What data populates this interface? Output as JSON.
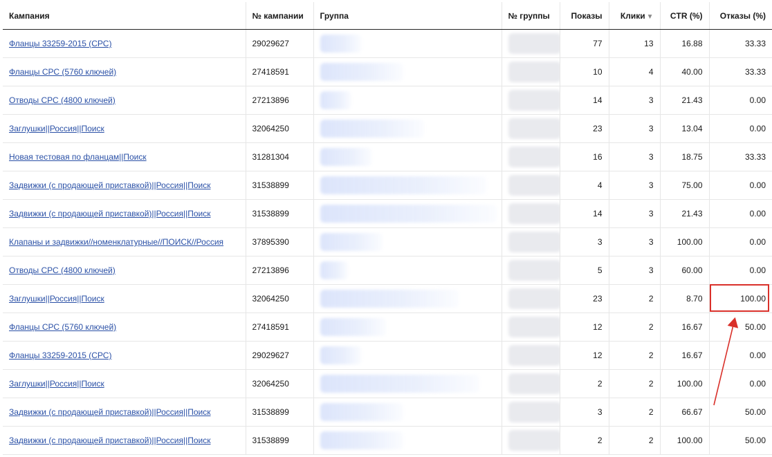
{
  "table": {
    "headers": {
      "campaign": "Кампания",
      "campaign_no": "№ кампании",
      "group": "Группа",
      "group_no": "№ группы",
      "impressions": "Показы",
      "clicks": "Клики",
      "ctr": "CTR (%)",
      "bounces": "Отказы (%)"
    },
    "sort_column": "clicks",
    "sort_icon": "sort-desc-icon",
    "rows": [
      {
        "campaign": "Фланцы 33259-2015 (СРС)",
        "campaign_no": "29029627",
        "impressions": "77",
        "clicks": "13",
        "ctr": "16.88",
        "bounces": "33.33"
      },
      {
        "campaign": "Фланцы СРС (5760 ключей)",
        "campaign_no": "27418591",
        "impressions": "10",
        "clicks": "4",
        "ctr": "40.00",
        "bounces": "33.33"
      },
      {
        "campaign": "Отводы СРС (4800 ключей)",
        "campaign_no": "27213896",
        "impressions": "14",
        "clicks": "3",
        "ctr": "21.43",
        "bounces": "0.00"
      },
      {
        "campaign": "Заглушки||Россия||Поиск",
        "campaign_no": "32064250",
        "impressions": "23",
        "clicks": "3",
        "ctr": "13.04",
        "bounces": "0.00"
      },
      {
        "campaign": "Новая тестовая по фланцам||Поиск",
        "campaign_no": "31281304",
        "impressions": "16",
        "clicks": "3",
        "ctr": "18.75",
        "bounces": "33.33"
      },
      {
        "campaign": "Задвижки (с продающей приставкой)||Россия||Поиск",
        "campaign_no": "31538899",
        "impressions": "4",
        "clicks": "3",
        "ctr": "75.00",
        "bounces": "0.00"
      },
      {
        "campaign": "Задвижки (с продающей приставкой)||Россия||Поиск",
        "campaign_no": "31538899",
        "impressions": "14",
        "clicks": "3",
        "ctr": "21.43",
        "bounces": "0.00"
      },
      {
        "campaign": "Клапаны и задвижки//номенклатурные//ПОИСК//Россия",
        "campaign_no": "37895390",
        "impressions": "3",
        "clicks": "3",
        "ctr": "100.00",
        "bounces": "0.00"
      },
      {
        "campaign": "Отводы СРС (4800 ключей)",
        "campaign_no": "27213896",
        "impressions": "5",
        "clicks": "3",
        "ctr": "60.00",
        "bounces": "0.00"
      },
      {
        "campaign": "Заглушки||Россия||Поиск",
        "campaign_no": "32064250",
        "impressions": "23",
        "clicks": "2",
        "ctr": "8.70",
        "bounces": "100.00"
      },
      {
        "campaign": "Фланцы СРС (5760 ключей)",
        "campaign_no": "27418591",
        "impressions": "12",
        "clicks": "2",
        "ctr": "16.67",
        "bounces": "50.00"
      },
      {
        "campaign": "Фланцы 33259-2015 (СРС)",
        "campaign_no": "29029627",
        "impressions": "12",
        "clicks": "2",
        "ctr": "16.67",
        "bounces": "0.00"
      },
      {
        "campaign": "Заглушки||Россия||Поиск",
        "campaign_no": "32064250",
        "impressions": "2",
        "clicks": "2",
        "ctr": "100.00",
        "bounces": "0.00"
      },
      {
        "campaign": "Задвижки (с продающей приставкой)||Россия||Поиск",
        "campaign_no": "31538899",
        "impressions": "3",
        "clicks": "2",
        "ctr": "66.67",
        "bounces": "50.00"
      },
      {
        "campaign": "Задвижки (с продающей приставкой)||Россия||Поиск",
        "campaign_no": "31538899",
        "impressions": "2",
        "clicks": "2",
        "ctr": "100.00",
        "bounces": "50.00"
      }
    ]
  },
  "annotation": {
    "highlight_color": "#d9302a",
    "highlighted_value": "100.00"
  },
  "colors": {
    "link": "#2a50a6",
    "border": "#e6e6e6"
  }
}
